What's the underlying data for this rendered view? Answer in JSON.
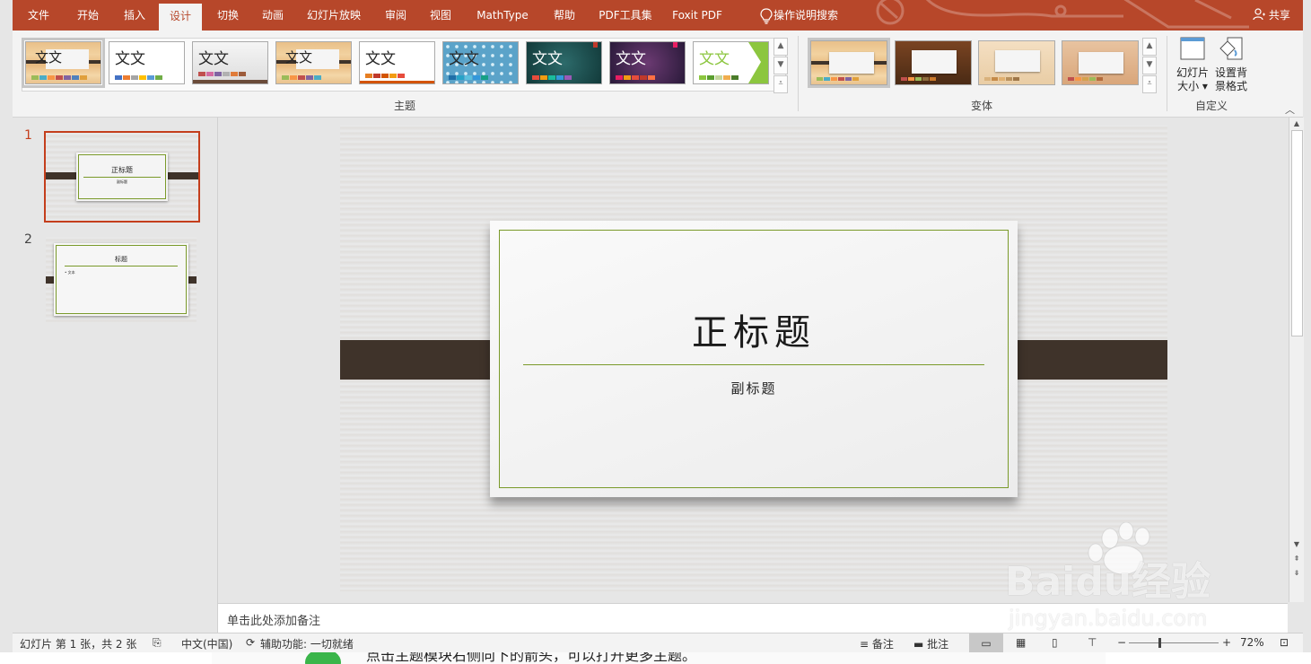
{
  "tabs": [
    "文件",
    "开始",
    "插入",
    "设计",
    "切换",
    "动画",
    "幻灯片放映",
    "审阅",
    "视图",
    "MathType",
    "帮助",
    "PDF工具集",
    "Foxit PDF"
  ],
  "active_tab": "设计",
  "tell_me": "操作说明搜索",
  "share": "共享",
  "ribbon": {
    "themes_label": "主题",
    "variants_label": "变体",
    "customize_label": "自定义",
    "theme_sample_text": "文文",
    "slide_size_label_1": "幻灯片",
    "slide_size_label_2": "大小",
    "format_bg_label_1": "设置背",
    "format_bg_label_2": "景格式"
  },
  "slides": [
    {
      "number": "1",
      "title": "正标题",
      "subtitle": "副标题"
    },
    {
      "number": "2",
      "title": "标题",
      "subtitle": "• 文本"
    }
  ],
  "slide": {
    "title": "正标题",
    "subtitle": "副标题"
  },
  "notes_placeholder": "单击此处添加备注",
  "status": {
    "slide_info": "幻灯片 第 1 张，共 2 张",
    "language": "中文(中国)",
    "accessibility": "辅助功能: 一切就绪",
    "notes": "备注",
    "comments": "批注",
    "zoom_minus": "−",
    "zoom_plus": "+",
    "zoom": "72%"
  },
  "watermark": {
    "brand": "Baidu经验",
    "url": "jingyan.baidu.com"
  },
  "below_text": "点击主题模块右侧向下的箭头，可以打开更多主题。",
  "colors": {
    "accent": "#b7472a",
    "slide_frame_green": "#7a9a2a",
    "strap": "#3f332a"
  }
}
